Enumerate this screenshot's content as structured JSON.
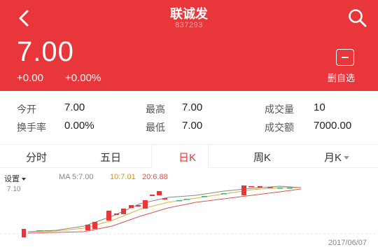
{
  "header": {
    "title": "联诚发",
    "code": "837293",
    "price": "7.00",
    "change": "+0.00",
    "change_pct": "+0.00%",
    "remove_label": "删自选",
    "bg_color": "#e8363b"
  },
  "icons": {
    "back": "back-arrow-icon",
    "search": "search-icon",
    "remove": "minus-square-icon"
  },
  "stats": {
    "open_label": "今开",
    "open_value": "7.00",
    "high_label": "最高",
    "high_value": "7.00",
    "volume_label": "成交量",
    "volume_value": "10",
    "turnover_rate_label": "换手率",
    "turnover_rate_value": "0.00%",
    "low_label": "最低",
    "low_value": "7.00",
    "amount_label": "成交额",
    "amount_value": "7000.00"
  },
  "tabs": {
    "intraday": "分时",
    "five_day": "五日",
    "daily": "日K",
    "weekly": "周K",
    "monthly": "月K",
    "active": "daily"
  },
  "chart": {
    "settings_label": "设置",
    "ma_label": "MA 5:7.00",
    "ma10_label": "10:7.01",
    "ma20_label": "20:6.88",
    "y_label": "7.10",
    "date_label": "2017/06/07",
    "colors": {
      "up": "#e8363b",
      "down": "#3cb371",
      "ma5": "#888888",
      "ma10": "#e0b030",
      "ma20": "#d9534f"
    }
  }
}
